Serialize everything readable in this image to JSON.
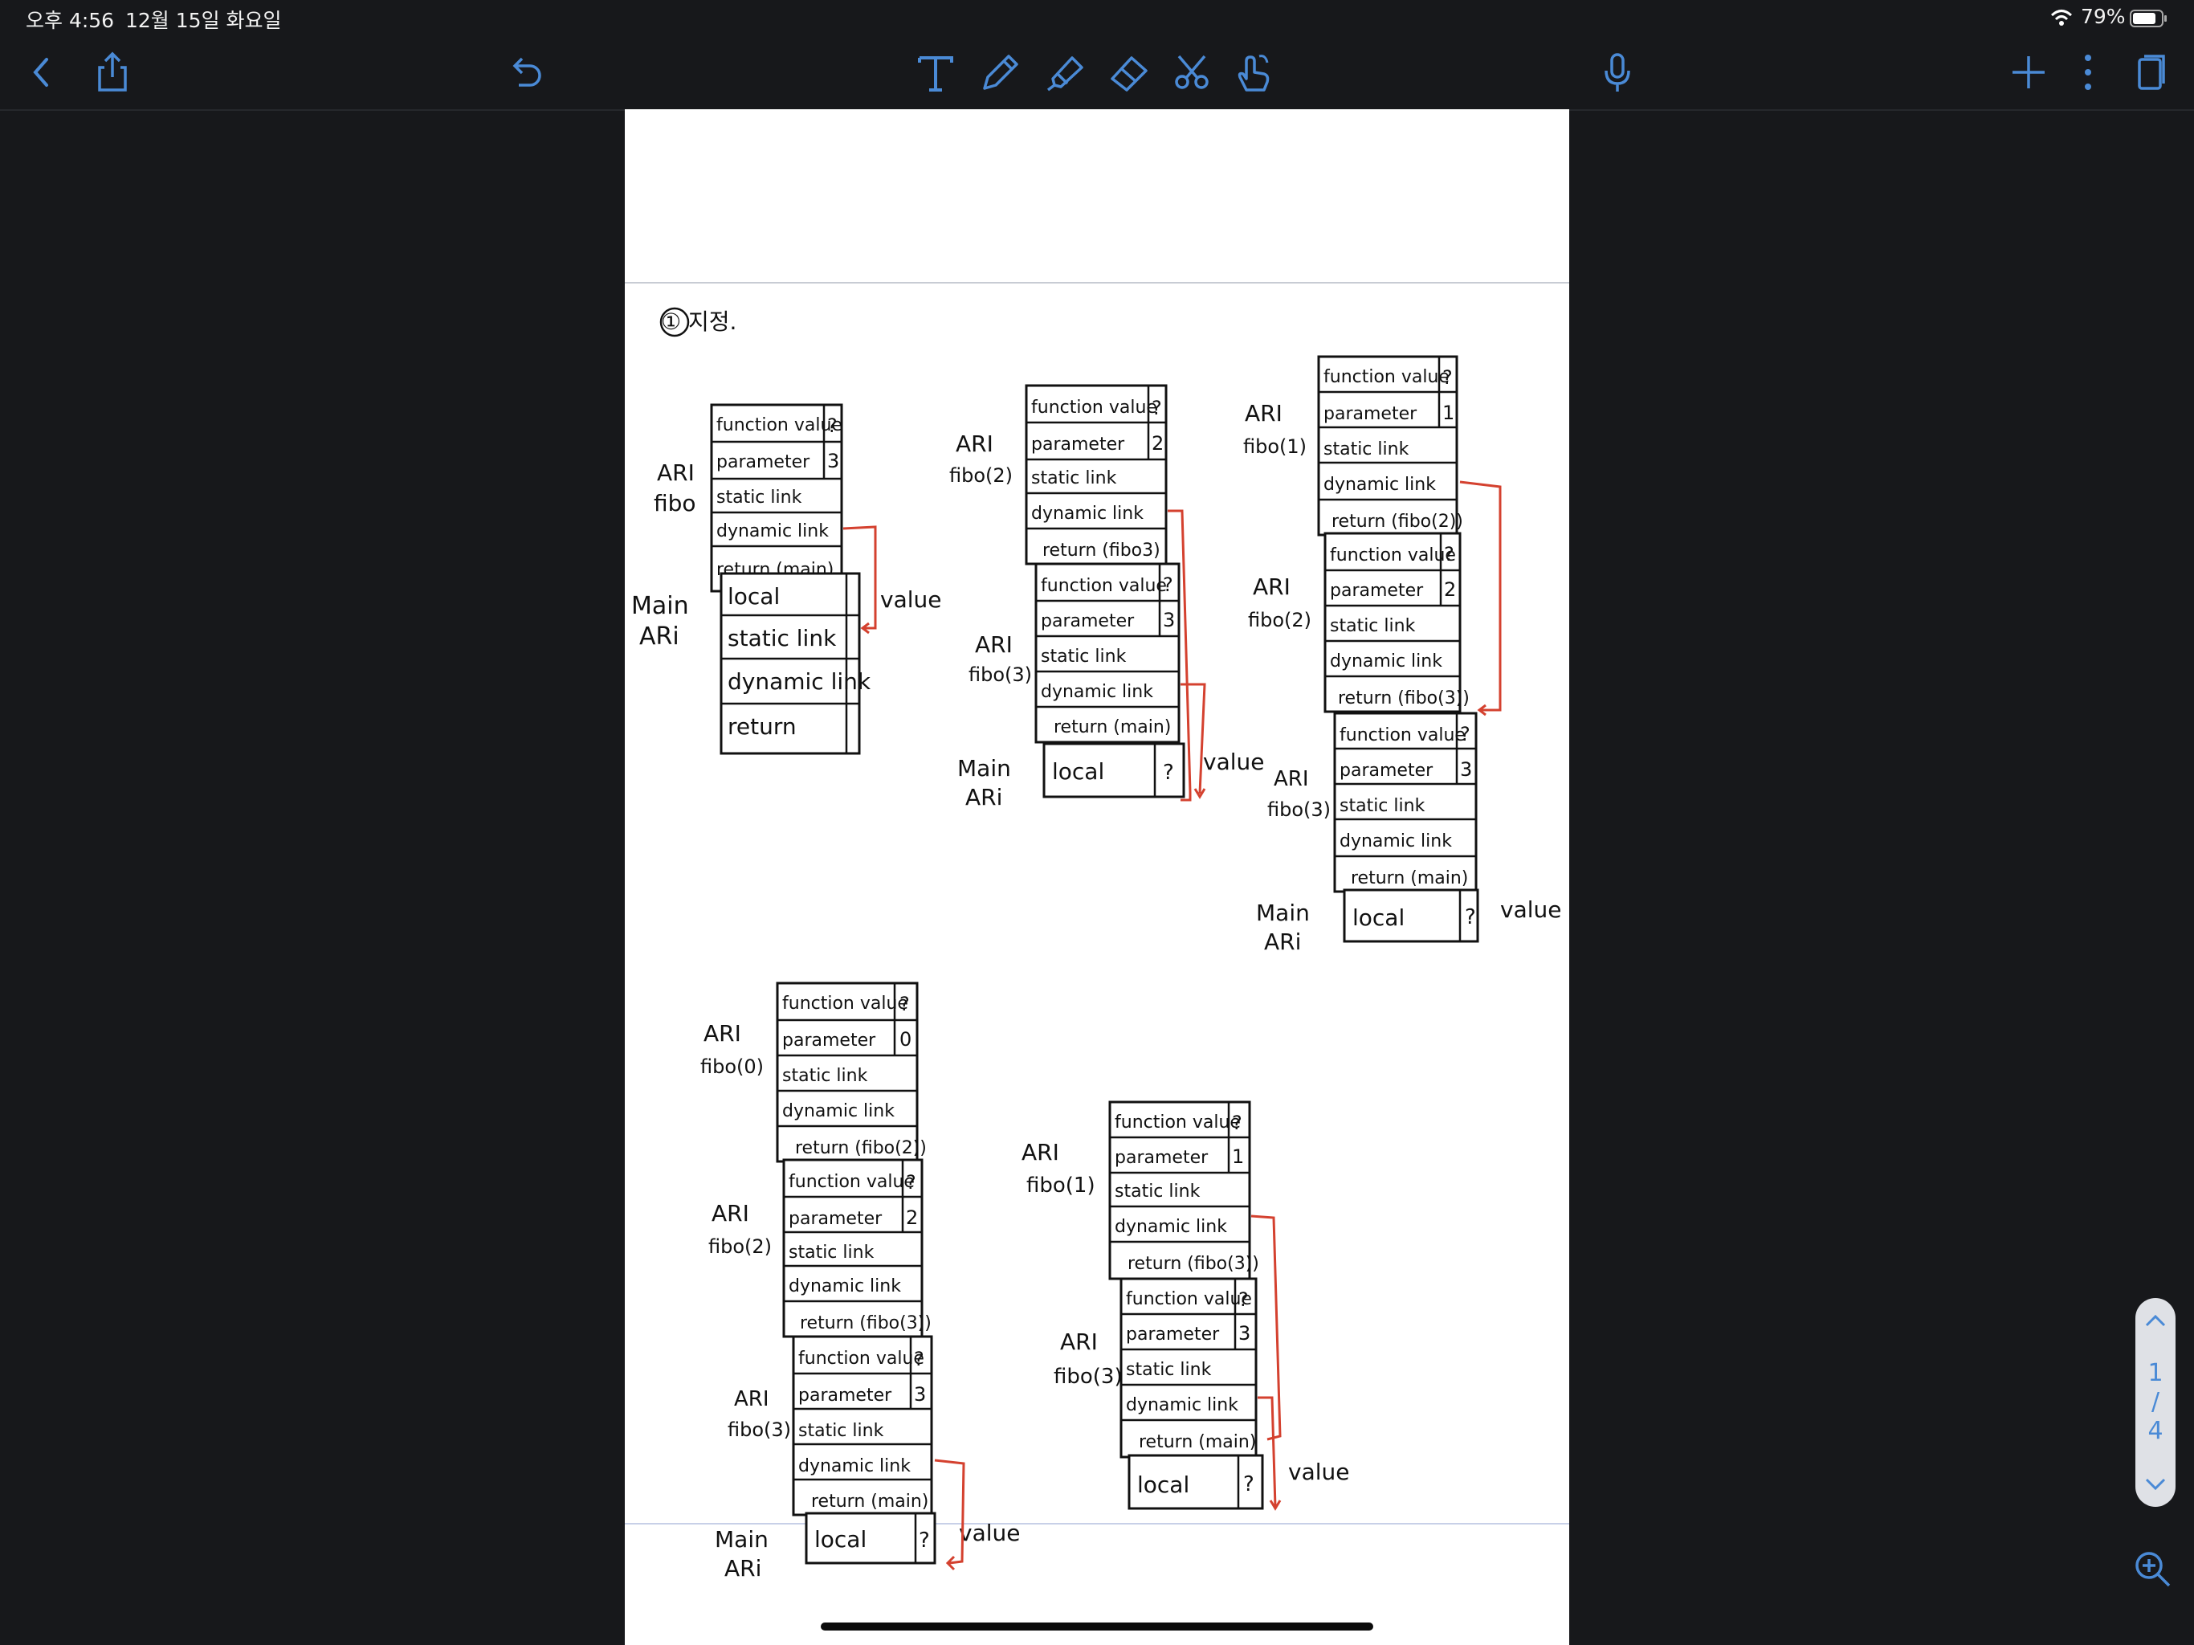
{
  "status": {
    "time": "오후 4:56",
    "date": "12월 15일 화요일",
    "battery": "79%"
  },
  "toolbar": {
    "icons": [
      "back-icon",
      "share-icon",
      "undo-icon",
      "text-tool-icon",
      "pen-tool-icon",
      "highlighter-tool-icon",
      "eraser-tool-icon",
      "lasso-scissors-icon",
      "gesture-hand-icon",
      "microphone-icon",
      "add-page-icon",
      "more-options-icon",
      "pages-view-icon"
    ],
    "accent": "#4a8ad6"
  },
  "note": {
    "heading": "① 지정.",
    "field_labels": [
      "function value",
      "parameter",
      "static link",
      "dynamic link",
      "return (main)",
      "return (fibo(2))",
      "return (fibo(3))",
      "local",
      "return"
    ],
    "values": [
      "?",
      "3",
      "2",
      "1",
      "0"
    ],
    "labels": [
      "ARI fibo",
      "Main ARi",
      "ARI fibo(2)",
      "ARI fibo(3)",
      "ARI fibo(1)",
      "ARI fibo(0)",
      "value"
    ],
    "link_color": "#d4412f"
  },
  "frames": {
    "g1_ari_label1": "ARI",
    "g1_ari_label2": "fibo",
    "g1_main_label1": "Main",
    "g1_main_label2": "ARi",
    "g1_value": "value",
    "g1_r1": "function value",
    "g1_r1v": "?",
    "g1_r2": "parameter",
    "g1_r2v": "3",
    "g1_r3": "static link",
    "g1_r4": "dynamic link",
    "g1_r5": "return (main)",
    "g1_m1": "local",
    "g1_m2": "static link",
    "g1_m3": "dynamic link",
    "g1_m4": "return",
    "g2_a_label1": "ARI",
    "g2_a_label2": "fibo(2)",
    "g2_b_label1": "ARI",
    "g2_b_label2": "fibo(3)",
    "g2_main_label1": "Main",
    "g2_main_label2": "ARi",
    "g2_value": "value",
    "g2_a1": "function value",
    "g2_a1v": "?",
    "g2_a2": "parameter",
    "g2_a2v": "2",
    "g2_a3": "static link",
    "g2_a4": "dynamic link",
    "g2_a5": "return (fibo3)",
    "g2_b1": "function value",
    "g2_b1v": "?",
    "g2_b2": "parameter",
    "g2_b2v": "3",
    "g2_b3": "static link",
    "g2_b4": "dynamic link",
    "g2_b5": "return (main)",
    "g2_local": "local",
    "g2_localv": "?",
    "g3_a_label1": "ARI",
    "g3_a_label2": "fibo(1)",
    "g3_b_label1": "ARI",
    "g3_b_label2": "fibo(2)",
    "g3_c_label1": "ARI",
    "g3_c_label2": "fibo(3)",
    "g3_main_label1": "Main",
    "g3_main_label2": "ARi",
    "g3_value": "value",
    "g3_a1": "function value",
    "g3_a1v": "?",
    "g3_a2": "parameter",
    "g3_a2v": "1",
    "g3_a3": "static link",
    "g3_a4": "dynamic link",
    "g3_a5": "return (fibo(2))",
    "g3_b1": "function value",
    "g3_b1v": "?",
    "g3_b2": "parameter",
    "g3_b2v": "2",
    "g3_b3": "static link",
    "g3_b4": "dynamic link",
    "g3_b5": "return (fibo(3))",
    "g3_c1": "function value",
    "g3_c1v": "?",
    "g3_c2": "parameter",
    "g3_c2v": "3",
    "g3_c3": "static link",
    "g3_c4": "dynamic link",
    "g3_c5": "return (main)",
    "g3_local": "local",
    "g3_localv": "?",
    "g4_a_label1": "ARI",
    "g4_a_label2": "fibo(0)",
    "g4_b_label1": "ARI",
    "g4_b_label2": "fibo(2)",
    "g4_c_label1": "ARI",
    "g4_c_label2": "fibo(3)",
    "g4_main_label1": "Main",
    "g4_main_label2": "ARi",
    "g4_value": "value",
    "g4_a1": "function value",
    "g4_a1v": "?",
    "g4_a2": "parameter",
    "g4_a2v": "0",
    "g4_a3": "static link",
    "g4_a4": "dynamic link",
    "g4_a5": "return (fibo(2))",
    "g4_b1": "function value",
    "g4_b1v": "?",
    "g4_b2": "parameter",
    "g4_b2v": "2",
    "g4_b3": "static link",
    "g4_b4": "dynamic link",
    "g4_b5": "return (fibo(3))",
    "g4_c1": "function value",
    "g4_c1v": "?",
    "g4_c2": "parameter",
    "g4_c2v": "3",
    "g4_c3": "static link",
    "g4_c4": "dynamic link",
    "g4_c5": "return (main)",
    "g4_local": "local",
    "g4_localv": "?",
    "g5_a_label1": "ARI",
    "g5_a_label2": "fibo(1)",
    "g5_b_label1": "ARI",
    "g5_b_label2": "fibo(3)",
    "g5_value": "value",
    "g5_a1": "function value",
    "g5_a1v": "?",
    "g5_a2": "parameter",
    "g5_a2v": "1",
    "g5_a3": "static link",
    "g5_a4": "dynamic link",
    "g5_a5": "return (fibo(3))",
    "g5_b1": "function value",
    "g5_b1v": "?",
    "g5_b2": "parameter",
    "g5_b2v": "3",
    "g5_b3": "static link",
    "g5_b4": "dynamic link",
    "g5_b5": "return (main)",
    "g5_local": "local",
    "g5_localv": "?"
  },
  "pager": {
    "current": "1",
    "separator": "/",
    "total": "4"
  }
}
